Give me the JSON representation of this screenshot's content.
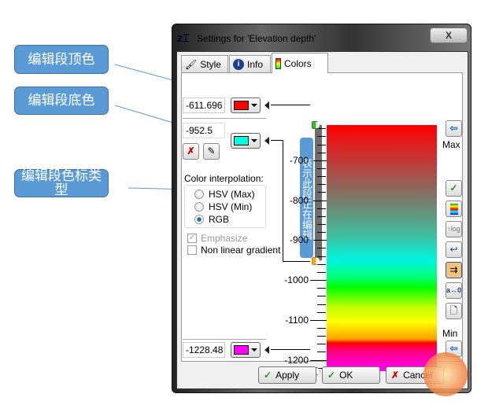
{
  "annotations": [
    {
      "text": "编辑段顶色"
    },
    {
      "text": "编辑段底色"
    },
    {
      "text": "编辑段色标类型"
    }
  ],
  "editing_label": "表示此段正在编辑",
  "window": {
    "title": "Settings for 'Elevation depth'",
    "close": "X"
  },
  "tabs": [
    {
      "label": "Style",
      "icon": "brush-icon"
    },
    {
      "label": "Info",
      "icon": "info-icon"
    },
    {
      "label": "Colors",
      "icon": "gradient-icon",
      "active": true
    }
  ],
  "segment": {
    "top_value": "-611.696",
    "top_color": "#ff0000",
    "bottom_value": "-952.5",
    "bottom_color": "#00ffe0",
    "min_value": "-1228.48",
    "min_color": "#ff00ff"
  },
  "interpolation": {
    "label": "Color interpolation:",
    "options": [
      {
        "label": "HSV (Max)",
        "selected": false
      },
      {
        "label": "HSV (Min)",
        "selected": false
      },
      {
        "label": "RGB",
        "selected": true
      }
    ]
  },
  "emphasize": {
    "label": "Emphasize",
    "checked": true,
    "disabled": true
  },
  "nonlinear": {
    "label": "Non linear gradient",
    "checked": false
  },
  "scale": {
    "max": -611.696,
    "min": -1228.48,
    "labels": [
      "-700",
      "-800",
      "-900",
      "-1000",
      "-1100",
      "-1200"
    ],
    "stops": [
      -611.696,
      -952.5,
      -1228.48
    ]
  },
  "side": {
    "max_label": "Max",
    "min_label": "Min",
    "log_label": "log"
  },
  "buttons": {
    "apply": "Apply",
    "ok": "OK",
    "cancel": "Cancel"
  }
}
